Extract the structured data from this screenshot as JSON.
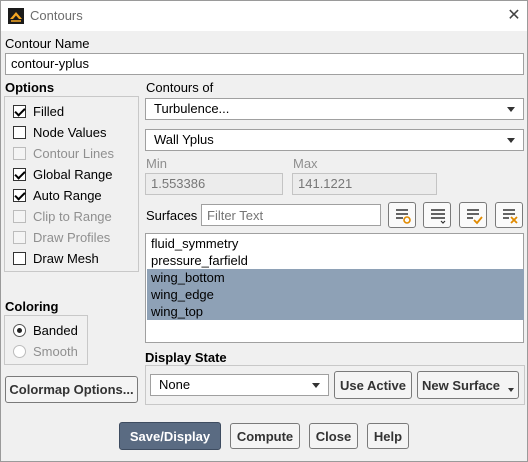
{
  "window": {
    "title": "Contours",
    "close_glyph": "✕"
  },
  "contour_name": {
    "label": "Contour Name",
    "value": "contour-yplus"
  },
  "options": {
    "label": "Options",
    "items": [
      {
        "label": "Filled",
        "checked": true,
        "enabled": true
      },
      {
        "label": "Node Values",
        "checked": false,
        "enabled": true
      },
      {
        "label": "Contour Lines",
        "checked": false,
        "enabled": false
      },
      {
        "label": "Global Range",
        "checked": true,
        "enabled": true
      },
      {
        "label": "Auto Range",
        "checked": true,
        "enabled": true
      },
      {
        "label": "Clip to Range",
        "checked": false,
        "enabled": false
      },
      {
        "label": "Draw Profiles",
        "checked": false,
        "enabled": false
      },
      {
        "label": "Draw Mesh",
        "checked": false,
        "enabled": true
      }
    ]
  },
  "coloring": {
    "label": "Coloring",
    "options": [
      {
        "label": "Banded",
        "selected": true,
        "enabled": true
      },
      {
        "label": "Smooth",
        "selected": false,
        "enabled": false
      }
    ]
  },
  "colormap_button": "Colormap Options...",
  "contours_of": {
    "label": "Contours of",
    "category": "Turbulence...",
    "variable": "Wall Yplus"
  },
  "range": {
    "min_label": "Min",
    "min_value": "1.553386",
    "max_label": "Max",
    "max_value": "141.1221"
  },
  "surfaces": {
    "label": "Surfaces",
    "filter_placeholder": "Filter Text",
    "items": [
      {
        "label": "fluid_symmetry",
        "selected": false
      },
      {
        "label": "pressure_farfield",
        "selected": false
      },
      {
        "label": "wing_bottom",
        "selected": true
      },
      {
        "label": "wing_edge",
        "selected": true
      },
      {
        "label": "wing_top",
        "selected": true
      }
    ],
    "tools": [
      "new-surface-list-icon",
      "select-all-icon",
      "check-selected-icon",
      "deselect-all-icon"
    ]
  },
  "display_state": {
    "label": "Display State",
    "value": "None",
    "use_active": "Use Active",
    "new_surface": "New Surface"
  },
  "buttons": {
    "save_display": "Save/Display",
    "compute": "Compute",
    "close": "Close",
    "help": "Help"
  },
  "colors": {
    "selection": "#8ea1b6",
    "primary_button": "#5a6b82"
  }
}
